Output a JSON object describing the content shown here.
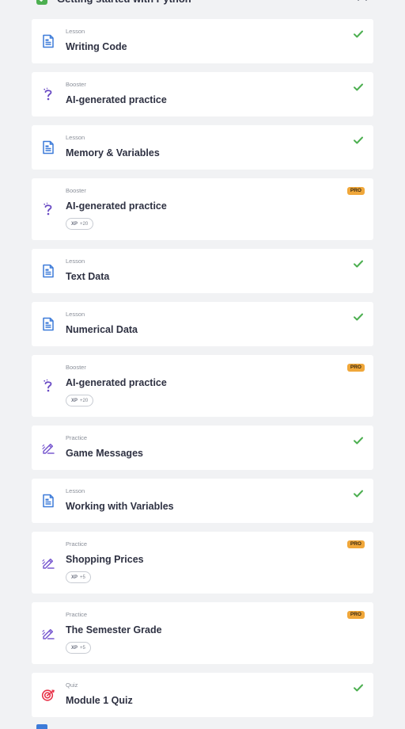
{
  "section": {
    "title": "Getting started with Python",
    "status": "completed"
  },
  "items": [
    {
      "type": "Lesson",
      "title": "Writing Code",
      "status": "completed",
      "icon": "lesson-icon"
    },
    {
      "type": "Booster",
      "title": "AI-generated practice",
      "status": "completed",
      "icon": "booster-icon"
    },
    {
      "type": "Lesson",
      "title": "Memory & Variables",
      "status": "completed",
      "icon": "lesson-icon"
    },
    {
      "type": "Booster",
      "title": "AI-generated practice",
      "status": "pro",
      "pro_label": "PRO",
      "xp_label": "XP",
      "xp_value": "+20",
      "icon": "booster-icon"
    },
    {
      "type": "Lesson",
      "title": "Text Data",
      "status": "completed",
      "icon": "lesson-icon"
    },
    {
      "type": "Lesson",
      "title": "Numerical Data",
      "status": "completed",
      "icon": "lesson-icon"
    },
    {
      "type": "Booster",
      "title": "AI-generated practice",
      "status": "pro",
      "pro_label": "PRO",
      "xp_label": "XP",
      "xp_value": "+20",
      "icon": "booster-icon"
    },
    {
      "type": "Practice",
      "title": "Game Messages",
      "status": "completed",
      "icon": "practice-icon"
    },
    {
      "type": "Lesson",
      "title": "Working with Variables",
      "status": "completed",
      "icon": "lesson-icon"
    },
    {
      "type": "Practice",
      "title": "Shopping Prices",
      "status": "pro",
      "pro_label": "PRO",
      "xp_label": "XP",
      "xp_value": "+5",
      "icon": "practice-icon"
    },
    {
      "type": "Practice",
      "title": "The Semester Grade",
      "status": "pro",
      "pro_label": "PRO",
      "xp_label": "XP",
      "xp_value": "+5",
      "icon": "practice-icon"
    },
    {
      "type": "Quiz",
      "title": "Module 1 Quiz",
      "status": "completed",
      "icon": "quiz-icon"
    }
  ],
  "colors": {
    "background": "#f1f2f4",
    "card": "#ffffff",
    "check": "#4caf50",
    "pro": "#f0a73a",
    "lesson": "#3d7bd9",
    "booster": "#6a4bc4",
    "practice": "#7a5bd0",
    "quiz": "#e8344a"
  }
}
